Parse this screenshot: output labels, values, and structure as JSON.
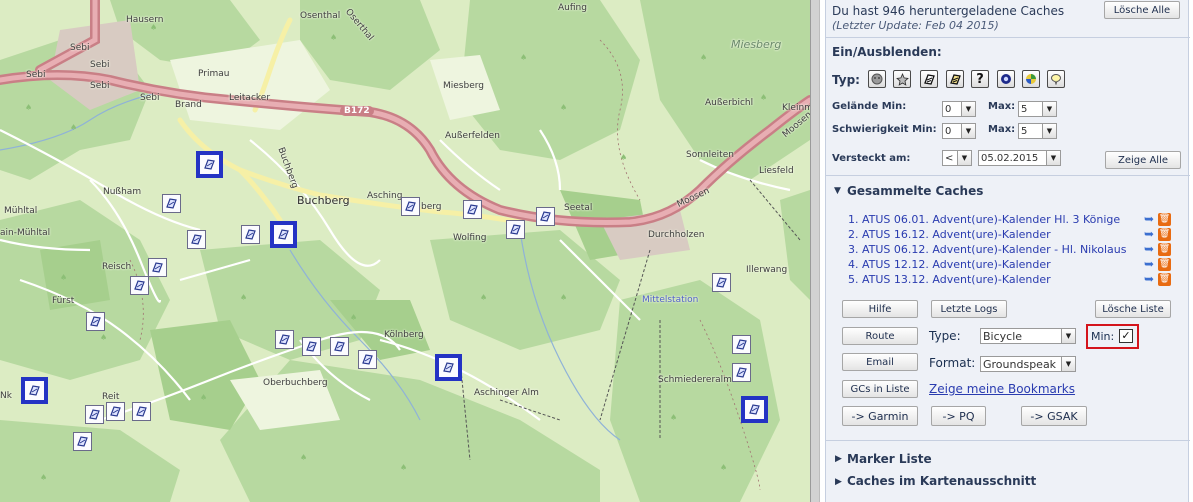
{
  "map": {
    "labels": {
      "hausern": "Hausern",
      "osenthal": "Osenthal",
      "oserthal": "Oserthal",
      "aufing": "Aufing",
      "miesberg_region": "Miesberg",
      "sebi1": "Sebi",
      "sebi2": "Sebi",
      "sebi3": "Sebi",
      "sebi4": "Sebi",
      "sebi5": "Sebi",
      "primau": "Primau",
      "brand": "Brand",
      "leitacker": "Leitacker",
      "miesberg": "Miesberg",
      "ausserbichl": "Außerbichl",
      "kleinm": "Kleinm",
      "b172": "B172",
      "ausserfelden": "Außerfelden",
      "sonnleiten": "Sonnleiten",
      "moosen1": "Moosen",
      "moosen2": "Moosen",
      "liesfeld": "Liesfeld",
      "nusham": "Nußham",
      "buchberg_small": "Buchberg",
      "buchberg": "Buchberg",
      "asching": "Asching",
      "berg": "berg",
      "seetal": "Seetal",
      "wolfing": "Wolfing",
      "durchholzen": "Durchholzen",
      "muhltal": "Mühltal",
      "ain_muhltal": "ain-Mühltal",
      "reisch": "Reisch",
      "illerwang": "Illerwang",
      "mittelstation": "Mittelstation",
      "furst": "Fürst",
      "kolnberg": "Kölnberg",
      "oberbuchberg": "Oberbuchberg",
      "schmiedereralm": "Schmiedereralm",
      "aschinger_alm": "Aschinger Alm",
      "reit": "Reit",
      "nk": "Nk"
    },
    "cache_icon": "multi-cache-icon"
  },
  "panel": {
    "download_info": "Du hast 946 heruntergeladene Caches",
    "last_update": "(Letzter Update: Feb 04 2015)",
    "delete_all": "Lösche Alle",
    "toggle_header": "Ein/Ausblenden:",
    "type_label": "Typ:",
    "type_icons": [
      "unknown-cache-icon",
      "star-icon",
      "traditional-cache-icon",
      "multi-cache-icon",
      "mystery-cache-icon",
      "earth-cache-icon",
      "webcam-cache-icon",
      "letterbox-icon"
    ],
    "terrain_min_label": "Gelände Min:",
    "terrain_min": "0",
    "terrain_max_label": "Max:",
    "terrain_max": "5",
    "difficulty_min_label": "Schwierigkeit Min:",
    "difficulty_min": "0",
    "difficulty_max_label": "Max:",
    "difficulty_max": "5",
    "hidden_label": "Versteckt am:",
    "hidden_op": "<",
    "hidden_date": "05.02.2015",
    "show_all": "Zeige Alle",
    "collected_header": "Gesammelte Caches",
    "collected": [
      "1. ATUS 06.01. Advent(ure)-Kalender Hl. 3 Könige",
      "2. ATUS 16.12. Advent(ure)-Kalender",
      "3. ATUS 06.12. Advent(ure)-Kalender - Hl. Nikolaus",
      "4. ATUS 12.12. Advent(ure)-Kalender",
      "5. ATUS 13.12. Advent(ure)-Kalender"
    ],
    "help": "Hilfe",
    "last_logs": "Letzte Logs",
    "delete_list": "Lösche Liste",
    "route": "Route",
    "type2_label": "Type:",
    "type2_value": "Bicycle",
    "min_label": "Min:",
    "min_check": "✓",
    "email": "Email",
    "format_label": "Format:",
    "format_value": "Groundspeak",
    "gcs_in_list": "GCs in Liste",
    "show_bookmarks": "Zeige meine Bookmarks",
    "garmin": "-> Garmin",
    "pq": "-> PQ",
    "gsak": "-> GSAK",
    "marker_list": "Marker Liste",
    "caches_in_map": "Caches im Kartenausschnitt"
  },
  "colors": {
    "highlight": "#d4141c",
    "selected_cache": "#2433c4",
    "link": "#2a3cb0",
    "trash": "#e86b12"
  }
}
